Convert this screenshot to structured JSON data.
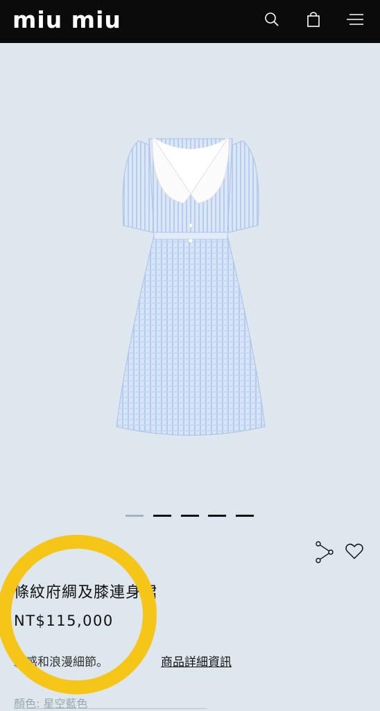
{
  "header": {
    "logo": "miu miu",
    "icons": [
      "search-icon",
      "bag-icon",
      "menu-icon"
    ]
  },
  "gallery": {
    "image_alt": "條紋府綢及膝連身裙",
    "slides": 5,
    "active_slide": 1
  },
  "product": {
    "title": "條紋府綢及膝連身裙",
    "price": "NT$115,000",
    "description": "款感和浪漫細節。",
    "details_link": "商品詳細資訊",
    "color_label": "顏色: 星空藍色"
  },
  "actions": {
    "share_icon": "share-icon",
    "wishlist_icon": "heart-icon"
  },
  "colors": {
    "background": "#dde7ed",
    "header": "#0b0b0b",
    "highlight": "#f5c518",
    "dot_active": "#9fb4c1"
  }
}
